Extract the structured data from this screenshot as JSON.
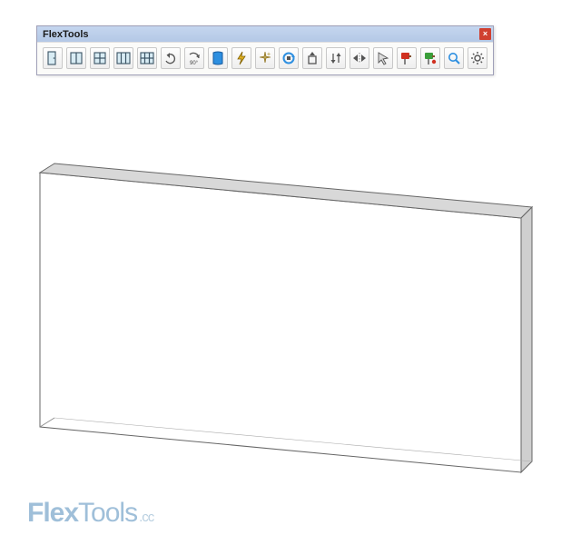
{
  "toolbar": {
    "title": "FlexTools",
    "close_glyph": "×",
    "buttons": [
      {
        "id": "door-single",
        "name": "door-single-icon"
      },
      {
        "id": "window-single",
        "name": "window-single-icon"
      },
      {
        "id": "window-double",
        "name": "window-double-icon"
      },
      {
        "id": "window-multi",
        "name": "window-multi-icon"
      },
      {
        "id": "grid-wall",
        "name": "grid-wall-icon"
      },
      {
        "id": "undo",
        "name": "undo-icon"
      },
      {
        "id": "rotate-90",
        "name": "rotate-90-icon"
      },
      {
        "id": "wall-cut",
        "name": "wall-cut-icon"
      },
      {
        "id": "lightning",
        "name": "lightning-icon"
      },
      {
        "id": "sparkle",
        "name": "sparkle-icon"
      },
      {
        "id": "reload-hole",
        "name": "reload-hole-icon"
      },
      {
        "id": "extrude",
        "name": "extrude-icon"
      },
      {
        "id": "swap-arrows",
        "name": "swap-arrows-icon"
      },
      {
        "id": "mirror",
        "name": "mirror-icon"
      },
      {
        "id": "pointer",
        "name": "pointer-icon"
      },
      {
        "id": "paint",
        "name": "paint-icon"
      },
      {
        "id": "paint-alt",
        "name": "paint-alt-icon"
      },
      {
        "id": "search",
        "name": "search-icon"
      },
      {
        "id": "settings",
        "name": "gear-icon"
      }
    ]
  },
  "watermark": {
    "bold": "Flex",
    "rest": "Tools",
    "suffix": ".cc"
  },
  "colors": {
    "titlebar": "#b4c8e6",
    "close": "#d04030",
    "watermark": "#9fbfd9"
  }
}
